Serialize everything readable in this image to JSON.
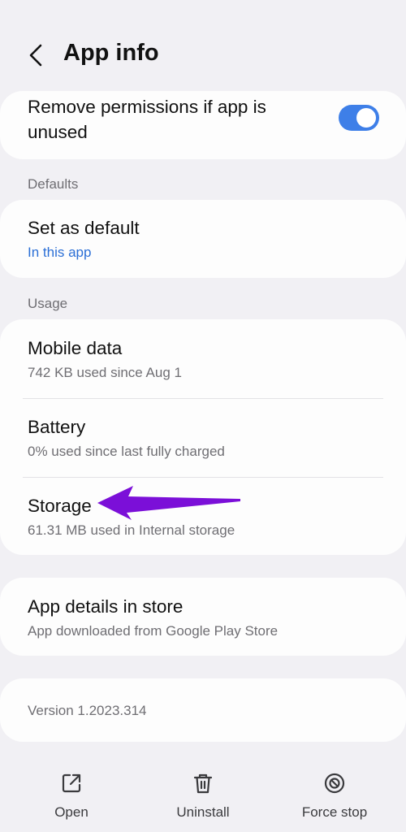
{
  "header": {
    "title": "App info"
  },
  "permissions": {
    "label": "Remove permissions if app is unused",
    "toggle_on": true
  },
  "defaults": {
    "section_label": "Defaults",
    "set_default_title": "Set as default",
    "set_default_sub": "In this app"
  },
  "usage": {
    "section_label": "Usage",
    "items": [
      {
        "title": "Mobile data",
        "sub": "742 KB used since Aug 1"
      },
      {
        "title": "Battery",
        "sub": "0% used since last fully charged"
      },
      {
        "title": "Storage",
        "sub": "61.31 MB used in Internal storage"
      }
    ]
  },
  "store": {
    "title": "App details in store",
    "sub": "App downloaded from Google Play Store"
  },
  "version": {
    "text": "Version 1.2023.314"
  },
  "actions": [
    {
      "label": "Open",
      "icon": "open-external-icon"
    },
    {
      "label": "Uninstall",
      "icon": "trash-icon"
    },
    {
      "label": "Force stop",
      "icon": "block-icon"
    }
  ],
  "colors": {
    "accent": "#3e7fe8",
    "link": "#2b6fd6",
    "annotation_arrow": "#7b0fd8",
    "background": "#f1f0f4",
    "card": "#fdfdfd"
  }
}
